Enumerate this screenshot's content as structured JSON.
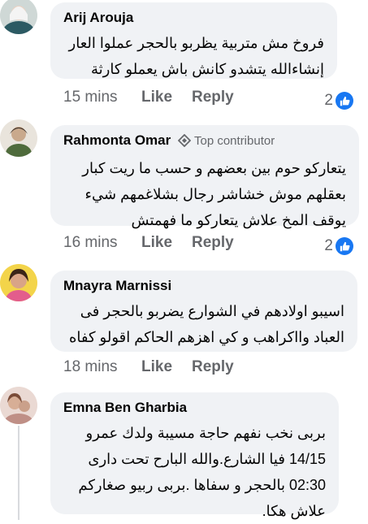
{
  "colors": {
    "bubble": "#f0f2f5",
    "meta_text": "#65676b",
    "like_blue": "#1877f2"
  },
  "comments": [
    {
      "author": "Arij Arouja",
      "lines": [
        "فروخ مش متربية يظربو بالحجر عملوا العار",
        "إنشاءالله يتشدو كانش باش يعملو كارثة"
      ],
      "time": "15 mins",
      "like": "Like",
      "reply": "Reply",
      "reaction_count": "2",
      "reaction_icon": "thumbs-up-icon"
    },
    {
      "author": "Rahmonta Omar",
      "badge": "Top contributor",
      "badge_icon": "diamond-icon",
      "lines": [
        "يتعاركو حوم بين بعضهم و حسب ما ريت كبار",
        "بعقلهم موش خشاشر رجال بشلاغمهم شيء",
        "يوقف المخ علاش يتعاركو ما فهمتش"
      ],
      "time": "16 mins",
      "like": "Like",
      "reply": "Reply",
      "reaction_count": "2",
      "reaction_icon": "thumbs-up-icon"
    },
    {
      "author": "Mnayra Marnissi",
      "lines": [
        "اسيبو اولادهم في الشوارع يضربو بالحجر فى",
        "العباد وااكراهب و كي اهزهم الحاكم اقولو كفاه"
      ],
      "time": "18 mins",
      "like": "Like",
      "reply": "Reply"
    },
    {
      "author": "Emna Ben Gharbia",
      "lines": [
        "بربى نخب نفهم حاجة مسيبة ولدك عمرو",
        "14/15 فيا الشارع.والله البارح تحت دارى",
        "02:30 بالحجر و سفاها .بربى ربيو صغاركم",
        "علاش هكا."
      ]
    }
  ]
}
